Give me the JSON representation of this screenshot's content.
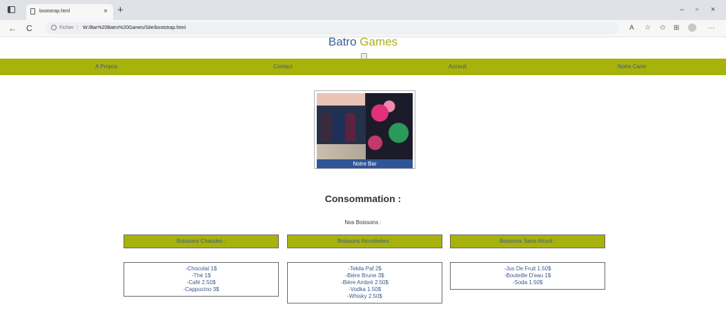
{
  "browser": {
    "tab_title": "bootstrap.html",
    "tab_close": "×",
    "new_tab": "+",
    "scheme_label": "Fichier",
    "url": "W:/Bar%20Batro%20Games/Site/bootstrap.html",
    "back": "←",
    "refresh": "C",
    "minimize": "–",
    "restore": "▫",
    "close": "×",
    "more": "···"
  },
  "header": {
    "brand_part1": "Batro",
    "brand_part2": "Games",
    "brand_color1": "#3a5d96",
    "brand_color2": "#a9b21a"
  },
  "nav": {
    "bg_color": "#a8b20d",
    "items": [
      "A Propos",
      "Contact",
      "Acceuil",
      "Notre Carte"
    ]
  },
  "gallery": {
    "caption": "Notre Bar"
  },
  "consommation": {
    "title": "Consommation :",
    "subtitle": "Nos Boissons :",
    "categories": [
      {
        "label": "Boissons Chaudes :",
        "items": [
          "-Chocolat 1$",
          "-Thé 1$",
          "-Café 2.50$",
          "-Cappucino 3$"
        ]
      },
      {
        "label": "Boissons Alcoolisées :",
        "items": [
          "-Tekila Paf 2$",
          "-Bière Brune 3$",
          "-Bière Ambré 2.50$",
          "-Vodka 1.50$",
          "-Whisky 2.50$"
        ]
      },
      {
        "label": "Boissons Sans Alcool :",
        "items": [
          "-Jus De Fruit 1.50$",
          "-Bouteille D'eau 1$",
          "-Soda 1.50$"
        ]
      }
    ]
  }
}
